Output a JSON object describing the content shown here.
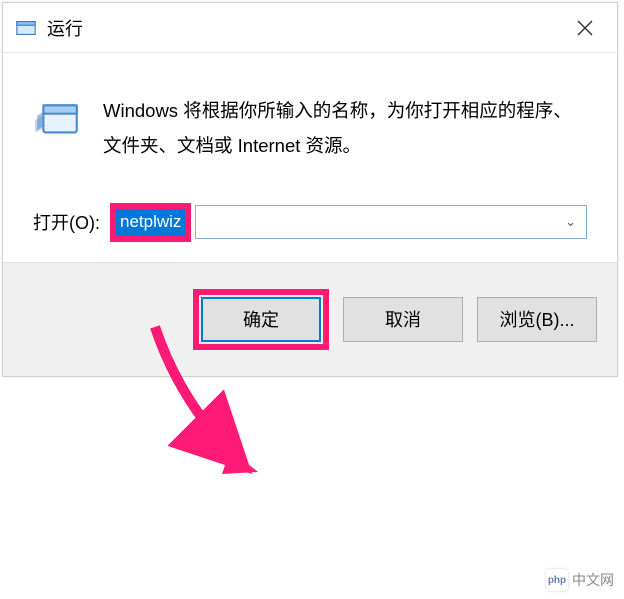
{
  "titlebar": {
    "title": "运行"
  },
  "message": "Windows 将根据你所输入的名称，为你打开相应的程序、文件夹、文档或 Internet 资源。",
  "open_label": "打开(O):",
  "input_value": "netplwiz",
  "buttons": {
    "ok": "确定",
    "cancel": "取消",
    "browse": "浏览(B)..."
  },
  "annotation": {
    "highlight_color": "#ff1a75",
    "arrow_from": "input-field",
    "arrow_to": "ok-button"
  },
  "watermark": {
    "logo_text": "php",
    "text": "中文网"
  }
}
